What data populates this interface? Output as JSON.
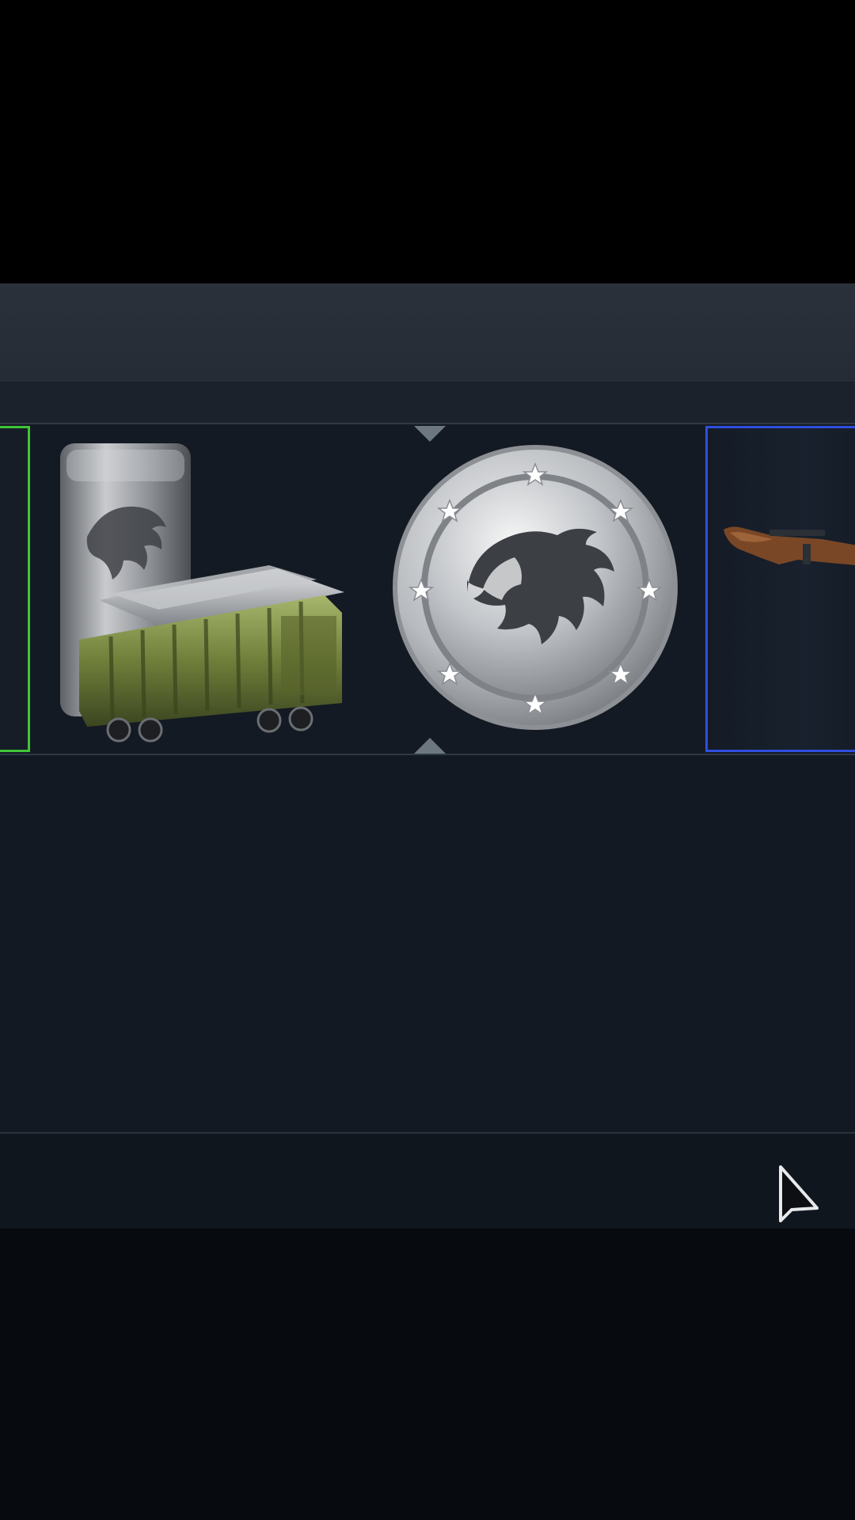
{
  "colors": {
    "header": "#272e37",
    "roulette_bg": "#141a23",
    "rarity_green": "#3fc637",
    "rarity_blue": "#2f4fe0",
    "bottom": "#070a0f"
  },
  "roulette": {
    "items": [
      {
        "icon": "green-rarity-item-edge",
        "rarity_color": "#3fc637"
      },
      {
        "icon": "silver-ingot-supply-wagon-icon"
      },
      {
        "icon": "silver-lion-coin-icon"
      },
      {
        "icon": "rifle-icon",
        "rarity_color": "#2f4fe0"
      }
    ],
    "pointer_icons": [
      "selection-marker-top-icon",
      "selection-marker-bottom-icon"
    ]
  },
  "cursor": {
    "icon": "mouse-cursor-icon"
  }
}
